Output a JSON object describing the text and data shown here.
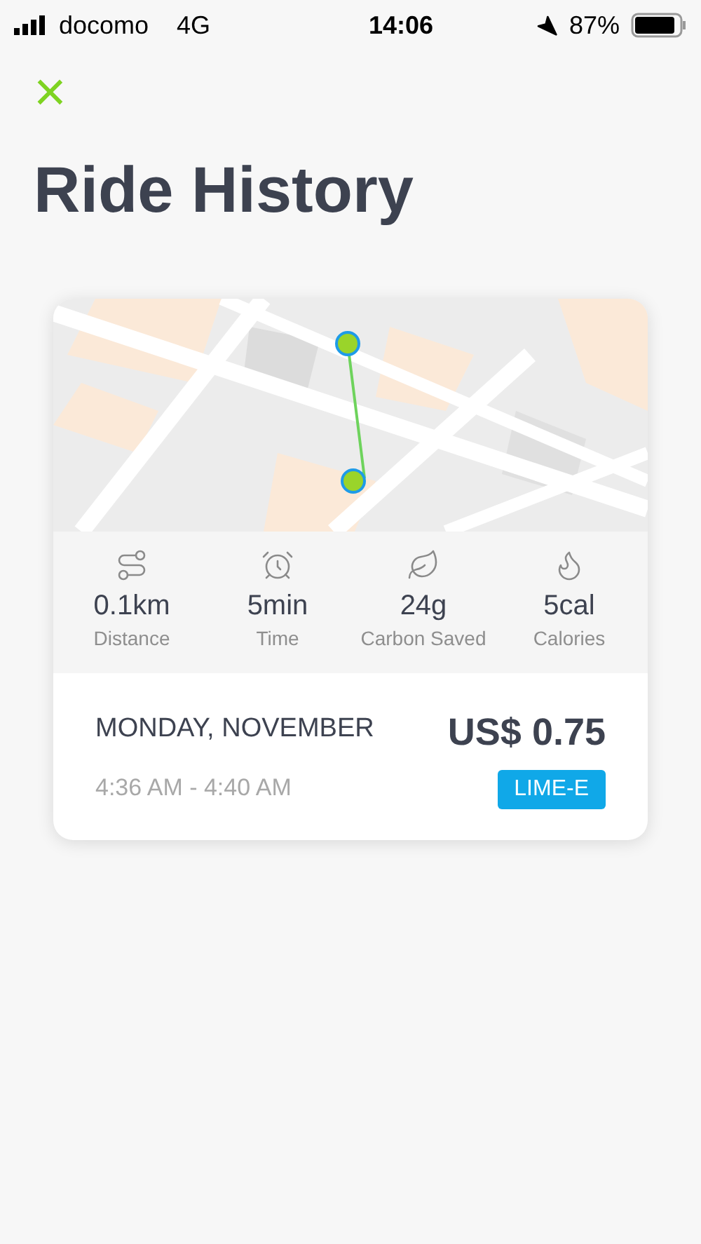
{
  "status_bar": {
    "carrier": "docomo",
    "network": "4G",
    "time": "14:06",
    "battery": "87%"
  },
  "close_button": {
    "label": "×"
  },
  "title": "Ride History",
  "ride": {
    "stats": [
      {
        "kind": "distance",
        "value": "0.1km",
        "label": "Distance"
      },
      {
        "kind": "time",
        "value": "5min",
        "label": "Time"
      },
      {
        "kind": "carbon",
        "value": "24g",
        "label": "Carbon Saved"
      },
      {
        "kind": "calories",
        "value": "5cal",
        "label": "Calories"
      }
    ],
    "date": "MONDAY, NOVEMBER",
    "time_range": "4:36 AM - 4:40 AM",
    "price": "US$ 0.75",
    "vehicle": "LIME-E"
  }
}
